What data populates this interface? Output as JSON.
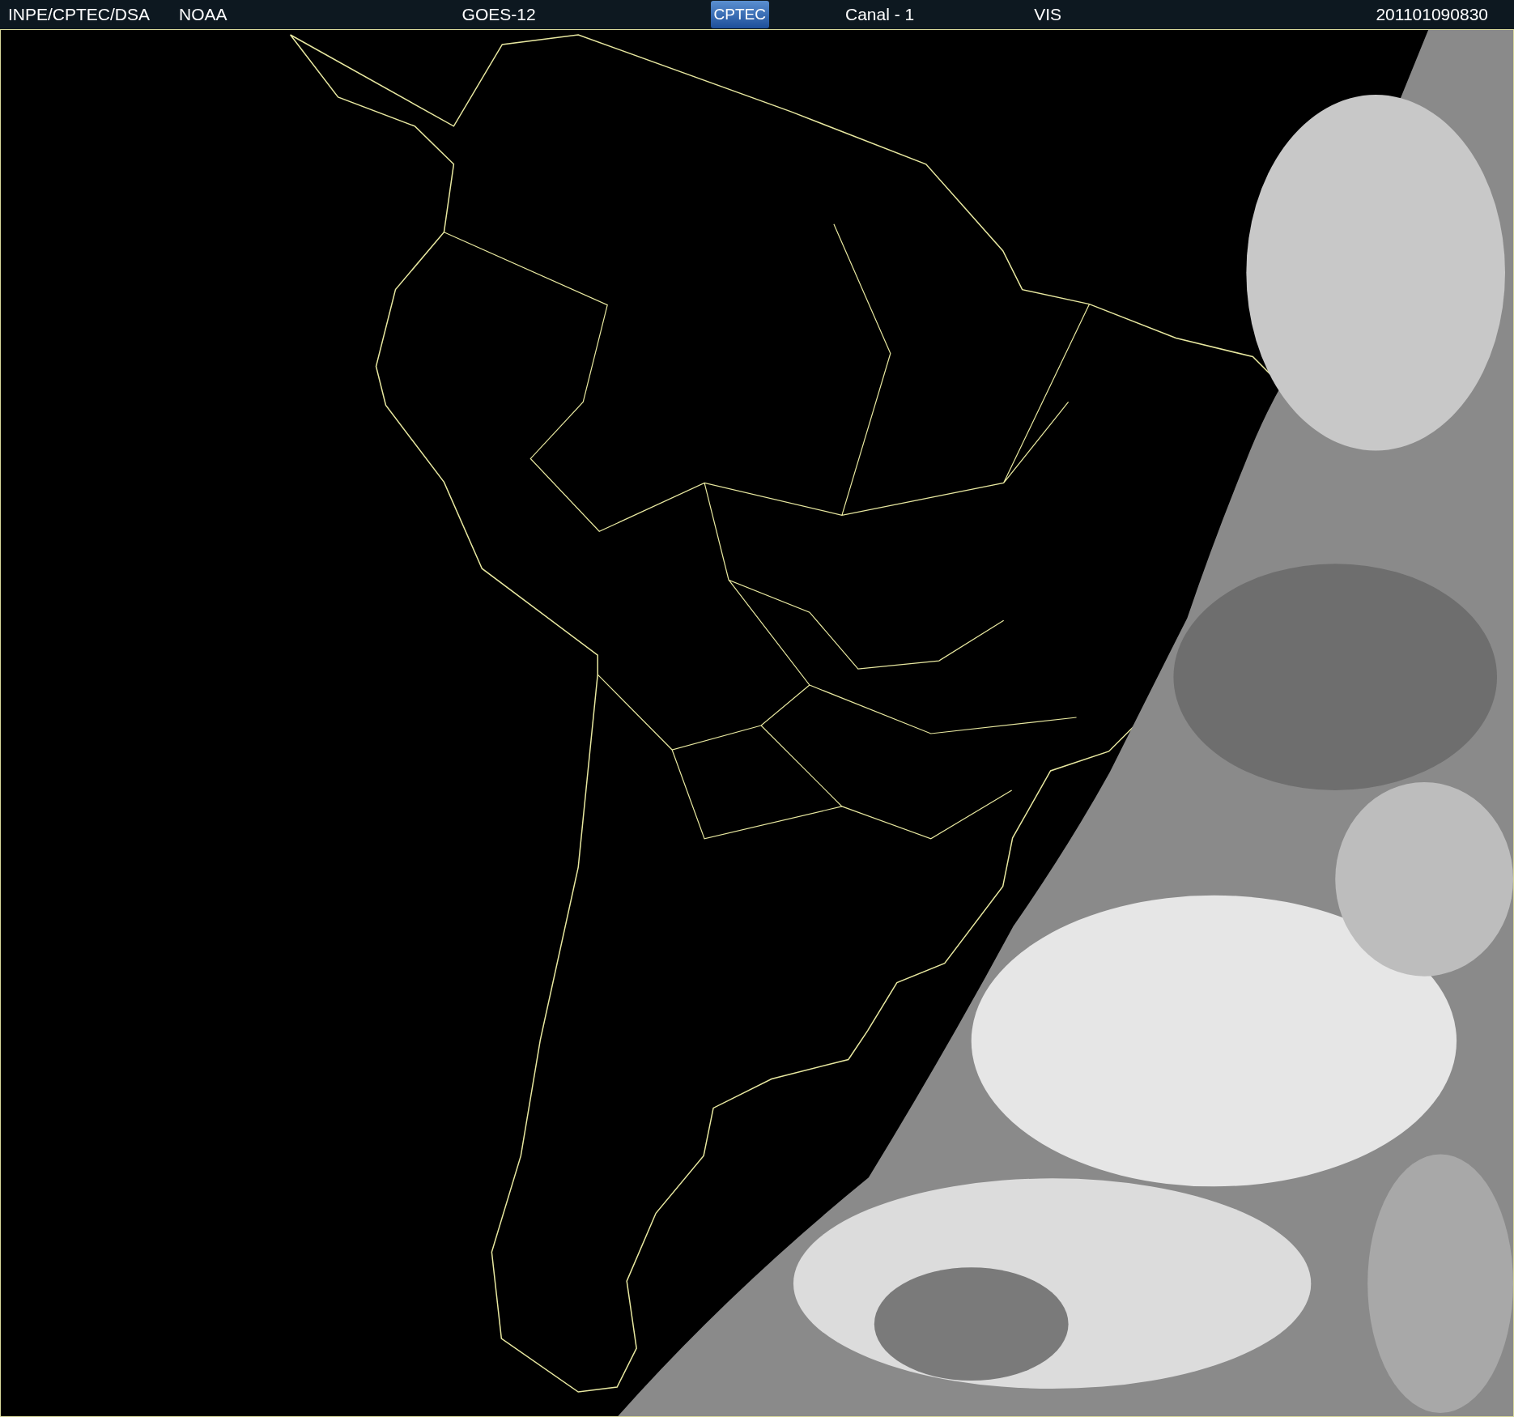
{
  "header": {
    "source": "INPE/CPTEC/DSA",
    "agency": "NOAA",
    "satellite": "GOES-12",
    "logo": "CPTEC",
    "channel": "Canal - 1",
    "band": "VIS",
    "timestamp": "201101090830"
  }
}
